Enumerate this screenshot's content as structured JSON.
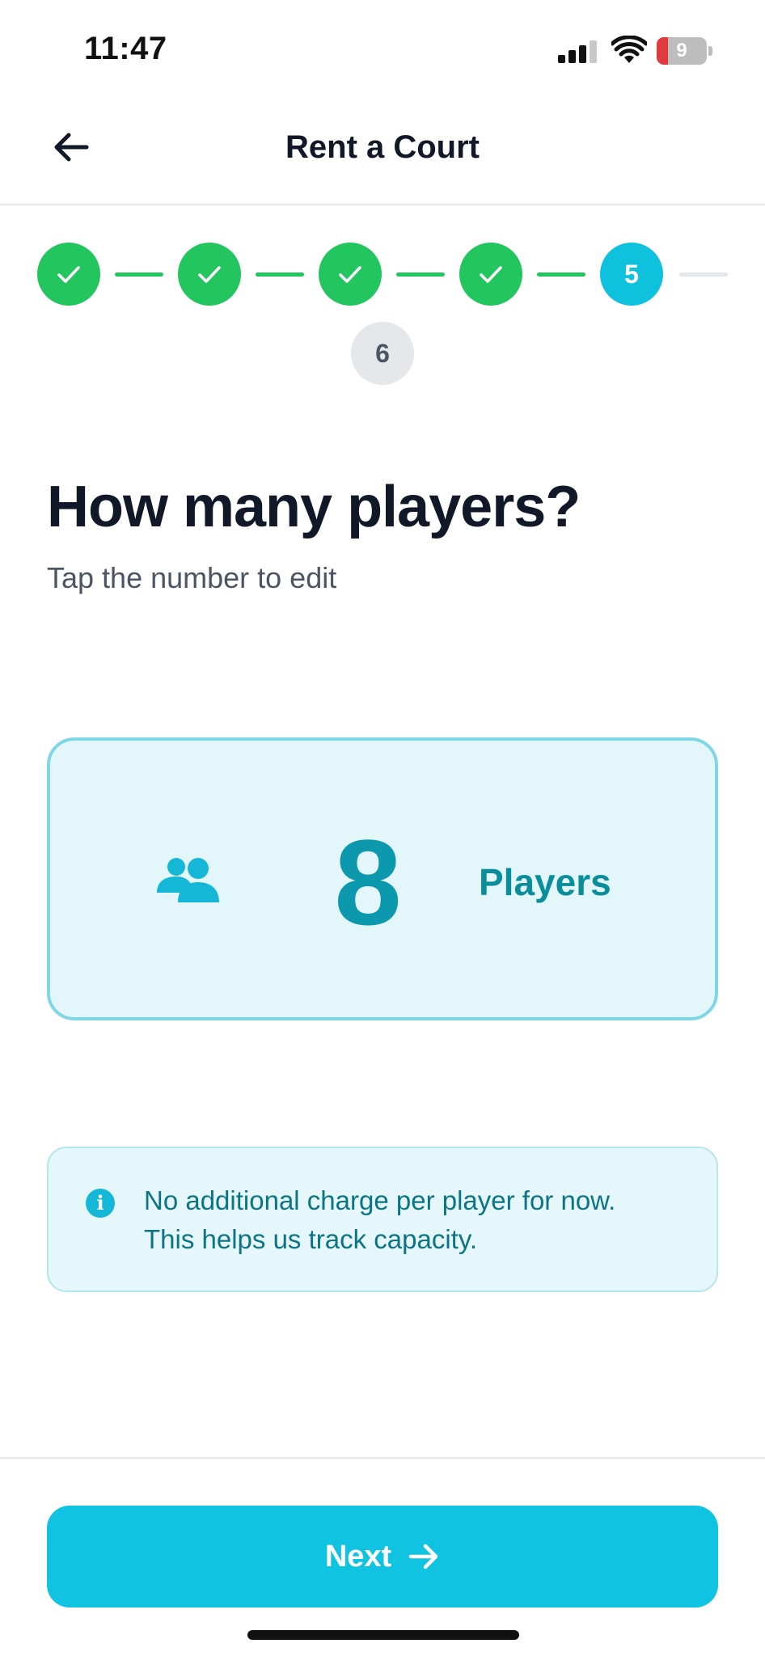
{
  "status_bar": {
    "time": "11:47",
    "battery_level": "9",
    "icons": [
      "cellular-signal-icon",
      "wifi-icon",
      "battery-icon"
    ]
  },
  "header": {
    "title": "Rent a Court",
    "back_icon": "arrow-left-icon"
  },
  "stepper": {
    "steps": [
      {
        "label": "",
        "state": "done",
        "icon": "check-icon"
      },
      {
        "label": "",
        "state": "done",
        "icon": "check-icon"
      },
      {
        "label": "",
        "state": "done",
        "icon": "check-icon"
      },
      {
        "label": "",
        "state": "done",
        "icon": "check-icon"
      },
      {
        "label": "5",
        "state": "current"
      },
      {
        "label": "6",
        "state": "future"
      }
    ]
  },
  "question": {
    "title": "How many players?",
    "subtitle": "Tap the number to edit"
  },
  "player_card": {
    "icon": "users-icon",
    "count": "8",
    "unit_label": "Players"
  },
  "info": {
    "icon": "info-icon",
    "line1": "No additional charge per player for now.",
    "line2": "This helps us track capacity."
  },
  "footer": {
    "next_label": "Next",
    "next_icon": "arrow-right-icon"
  },
  "colors": {
    "done": "#22c55e",
    "current": "#0ec1dd",
    "accent": "#10c3e0",
    "card_bg": "#e3f6fa",
    "count_text": "#0c98ad"
  }
}
